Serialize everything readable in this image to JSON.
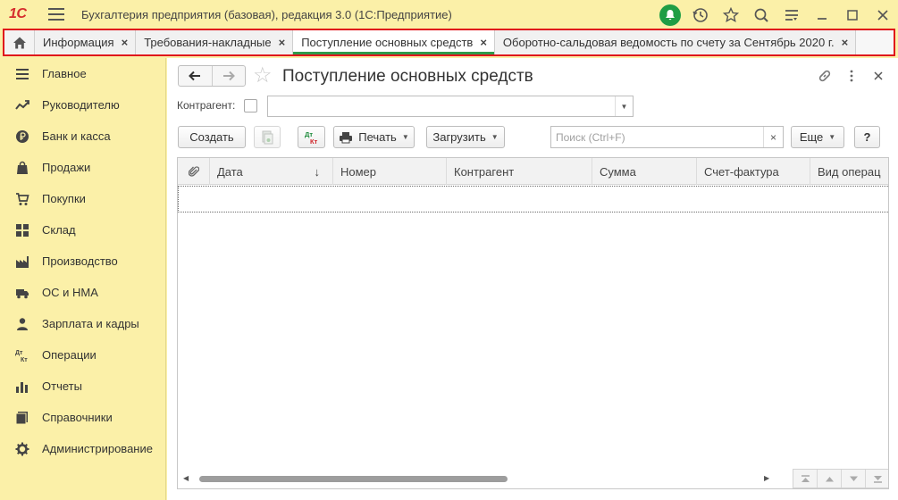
{
  "app": {
    "logo": "1С",
    "title": "Бухгалтерия предприятия (базовая), редакция 3.0  (1С:Предприятие)"
  },
  "titlebar_icons": [
    "bell-icon",
    "history-icon",
    "star-icon",
    "search-icon",
    "settings-icon",
    "minimize-icon",
    "maximize-icon",
    "close-icon"
  ],
  "tabs": [
    {
      "label": "Информация",
      "active": false
    },
    {
      "label": "Требования-накладные",
      "active": false
    },
    {
      "label": "Поступление основных средств",
      "active": true
    },
    {
      "label": "Оборотно-сальдовая ведомость по счету  за Сентябрь 2020 г.",
      "active": false
    }
  ],
  "tab_close": "×",
  "sidebar": {
    "items": [
      {
        "label": "Главное",
        "icon": "menu-lines-icon"
      },
      {
        "label": "Руководителю",
        "icon": "trend-icon"
      },
      {
        "label": "Банк и касса",
        "icon": "ruble-coin-icon"
      },
      {
        "label": "Продажи",
        "icon": "shopping-bag-icon"
      },
      {
        "label": "Покупки",
        "icon": "cart-icon"
      },
      {
        "label": "Склад",
        "icon": "warehouse-icon"
      },
      {
        "label": "Производство",
        "icon": "factory-icon"
      },
      {
        "label": "ОС и НМА",
        "icon": "truck-icon"
      },
      {
        "label": "Зарплата и кадры",
        "icon": "person-icon"
      },
      {
        "label": "Операции",
        "icon": "debit-credit-icon"
      },
      {
        "label": "Отчеты",
        "icon": "bar-chart-icon"
      },
      {
        "label": "Справочники",
        "icon": "books-icon"
      },
      {
        "label": "Администрирование",
        "icon": "gear-icon"
      }
    ]
  },
  "document": {
    "title": "Поступление основных средств"
  },
  "filter": {
    "label": "Контрагент:",
    "checked": false,
    "value": ""
  },
  "toolbar": {
    "create": "Создать",
    "dtkt_top": "Дт",
    "dtkt_bottom": "Кт",
    "print": "Печать",
    "load": "Загрузить",
    "search_placeholder": "Поиск (Ctrl+F)",
    "search_clear": "×",
    "more": "Еще",
    "help": "?"
  },
  "table": {
    "columns": [
      "Дата",
      "Номер",
      "Контрагент",
      "Сумма",
      "Счет-фактура",
      "Вид операц"
    ],
    "sort_indicator": "↓",
    "rows": []
  },
  "colors": {
    "sidebar_bg": "#fbf0a8",
    "accent_green": "#2f9a4a",
    "highlight_red": "#e0141b",
    "logo_red": "#d52d2d"
  }
}
